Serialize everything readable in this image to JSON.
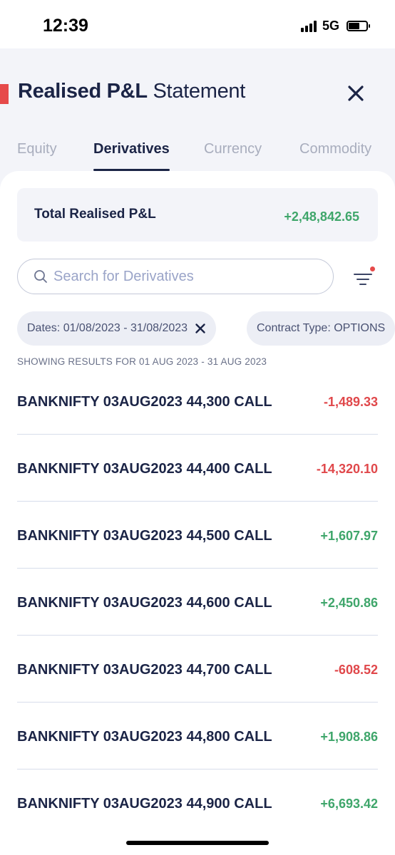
{
  "status_bar": {
    "time": "12:39",
    "network": "5G",
    "battery_level": 0.62
  },
  "header": {
    "title_bold": "Realised P&L",
    "title_rest": "Statement",
    "close_icon": "close-icon"
  },
  "tabs": [
    {
      "label": "Equity",
      "active": false
    },
    {
      "label": "Derivatives",
      "active": true
    },
    {
      "label": "Currency",
      "active": false
    },
    {
      "label": "Commodity",
      "active": false
    }
  ],
  "summary": {
    "label": "Total Realised P&L",
    "value": "+2,48,842.65"
  },
  "search": {
    "placeholder": "Search for Derivatives",
    "value": ""
  },
  "filters": {
    "chips": [
      {
        "label": "Dates: 01/08/2023 - 31/08/2023",
        "removable": true
      },
      {
        "label": "Contract Type: OPTIONS",
        "removable": false
      }
    ]
  },
  "results_note": "SHOWING RESULTS FOR 01 AUG 2023 - 31 AUG 2023",
  "rows": [
    {
      "name": "BANKNIFTY 03AUG2023 44,300 CALL",
      "value": "-1,489.33",
      "sign": "neg"
    },
    {
      "name": "BANKNIFTY 03AUG2023 44,400 CALL",
      "value": "-14,320.10",
      "sign": "neg"
    },
    {
      "name": "BANKNIFTY 03AUG2023 44,500 CALL",
      "value": "+1,607.97",
      "sign": "pos"
    },
    {
      "name": "BANKNIFTY 03AUG2023 44,600 CALL",
      "value": "+2,450.86",
      "sign": "pos"
    },
    {
      "name": "BANKNIFTY 03AUG2023 44,700 CALL",
      "value": "-608.52",
      "sign": "neg"
    },
    {
      "name": "BANKNIFTY 03AUG2023 44,800 CALL",
      "value": "+1,908.86",
      "sign": "pos"
    },
    {
      "name": "BANKNIFTY 03AUG2023 44,900 CALL",
      "value": "+6,693.42",
      "sign": "pos"
    }
  ],
  "colors": {
    "accent": "#e64a4a",
    "positive": "#3fa66b",
    "negative": "#e0484b",
    "navy": "#1b2446"
  }
}
